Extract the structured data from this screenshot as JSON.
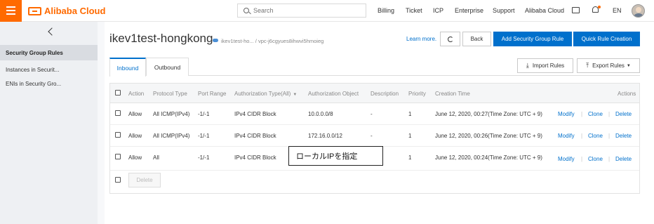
{
  "topbar": {
    "logo_text": "Alibaba Cloud",
    "search_placeholder": "Search",
    "nav": [
      "Billing",
      "Ticket",
      "ICP",
      "Enterprise",
      "Support",
      "Alibaba Cloud"
    ],
    "language": "EN",
    "accent_color": "#ff6a00"
  },
  "sidebar": {
    "items": [
      {
        "label": "Security Group Rules",
        "active": true
      },
      {
        "label": "Instances in Securit...",
        "active": false
      },
      {
        "label": "ENIs in Security Gro...",
        "active": false
      }
    ]
  },
  "header": {
    "title": "ikev1test-hongkong",
    "breadcrumb": "ikev1test-ho... / vpc-j6cgyues8ihwvi5hmoieg",
    "learn_more": "Learn more.",
    "back_label": "Back",
    "add_rule_label": "Add Security Group Rule",
    "quick_rule_label": "Quick Rule Creation",
    "primary_color": "#0070cc"
  },
  "tabs": {
    "inbound": "Inbound",
    "outbound": "Outbound",
    "import_label": "Import Rules",
    "export_label": "Export Rules"
  },
  "table": {
    "headers": {
      "action": "Action",
      "protocol": "Protocol Type",
      "port": "Port Range",
      "auth_type": "Authorization Type(All)",
      "auth_object": "Authorization Object",
      "description": "Description",
      "priority": "Priority",
      "created": "Creation Time",
      "actions": "Actions"
    },
    "rows": [
      {
        "action": "Allow",
        "protocol": "All ICMP(IPv4)",
        "port": "-1/-1",
        "auth_type": "IPv4 CIDR Block",
        "auth_object": "10.0.0.0/8",
        "description": "-",
        "priority": "1",
        "created": "June 12, 2020, 00:27(Time Zone: UTC + 9)"
      },
      {
        "action": "Allow",
        "protocol": "All ICMP(IPv4)",
        "port": "-1/-1",
        "auth_type": "IPv4 CIDR Block",
        "auth_object": "172.16.0.0/12",
        "description": "-",
        "priority": "1",
        "created": "June 12, 2020, 00:26(Time Zone: UTC + 9)"
      },
      {
        "action": "Allow",
        "protocol": "All",
        "port": "-1/-1",
        "auth_type": "IPv4 CIDR Block",
        "auth_object": "",
        "description": "-",
        "priority": "1",
        "created": "June 12, 2020, 00:24(Time Zone: UTC + 9)"
      }
    ],
    "row_actions": {
      "modify": "Modify",
      "clone": "Clone",
      "delete": "Delete",
      "separator": "|"
    },
    "delete_button": "Delete"
  },
  "callout": {
    "text": "ローカルIPを指定"
  }
}
